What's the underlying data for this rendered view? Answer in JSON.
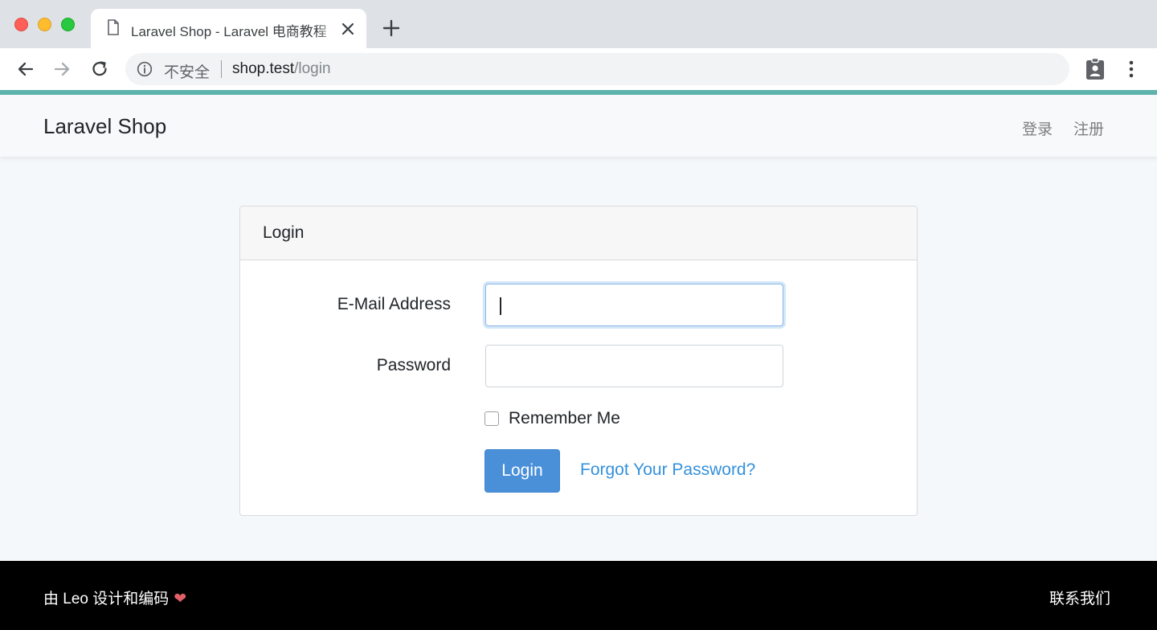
{
  "browser": {
    "tab_title": "Laravel Shop - Laravel 电商教程",
    "new_tab_symbol": "+",
    "security_label": "不安全",
    "url_host": "shop.test",
    "url_path": "/login"
  },
  "navbar": {
    "brand": "Laravel Shop",
    "login_link": "登录",
    "register_link": "注册"
  },
  "card": {
    "title": "Login",
    "email_label": "E-Mail Address",
    "email_value": "",
    "password_label": "Password",
    "password_value": "",
    "remember_label": "Remember Me",
    "remember_checked": false,
    "login_button": "Login",
    "forgot_link": "Forgot Your Password?"
  },
  "footer": {
    "credit": "由 Leo 设计和编码",
    "heart": "❤",
    "contact": "联系我们"
  },
  "colors": {
    "accent_bar": "#5fb5ad",
    "primary_button": "#4a90d9",
    "link": "#3490dc",
    "footer_bg": "#000000",
    "heart": "#e15f67"
  },
  "icons": [
    "document-icon",
    "close-icon",
    "plus-icon",
    "back-arrow-icon",
    "forward-arrow-icon",
    "reload-icon",
    "info-icon",
    "profile-badge-icon",
    "kebab-menu-icon",
    "heart-icon"
  ]
}
